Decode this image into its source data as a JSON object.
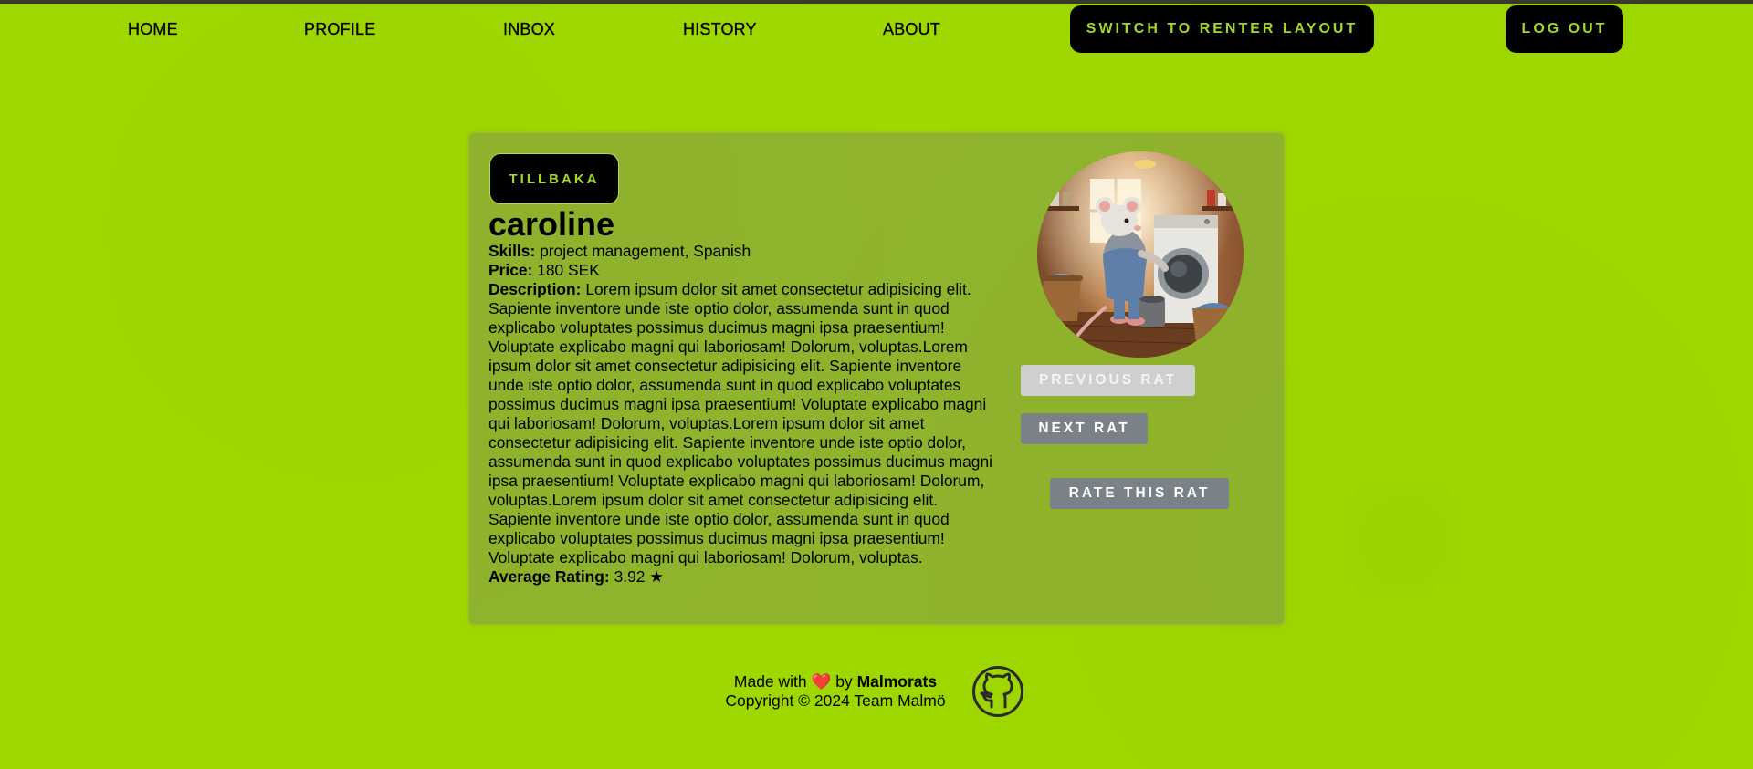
{
  "nav": {
    "home": "HOME",
    "profile": "PROFILE",
    "inbox": "INBOX",
    "history": "HISTORY",
    "about": "ABOUT",
    "switch_layout": "SWITCH TO RENTER LAYOUT",
    "logout": "LOG OUT"
  },
  "card": {
    "back_label": "TILLBAKA",
    "name": "caroline",
    "skills_label": "Skills:",
    "skills": "project management, Spanish",
    "price_label": "Price:",
    "price": "180 SEK",
    "description_label": "Description:",
    "description": "Lorem ipsum dolor sit amet consectetur adipisicing elit. Sapiente inventore unde iste optio dolor, assumenda sunt in quod explicabo voluptates possimus ducimus magni ipsa praesentium! Voluptate explicabo magni qui laboriosam! Dolorum, voluptas.Lorem ipsum dolor sit amet consectetur adipisicing elit. Sapiente inventore unde iste optio dolor, assumenda sunt in quod explicabo voluptates possimus ducimus magni ipsa praesentium! Voluptate explicabo magni qui laboriosam! Dolorum, voluptas.Lorem ipsum dolor sit amet consectetur adipisicing elit. Sapiente inventore unde iste optio dolor, assumenda sunt in quod explicabo voluptates possimus ducimus magni ipsa praesentium! Voluptate explicabo magni qui laboriosam! Dolorum, voluptas.Lorem ipsum dolor sit amet consectetur adipisicing elit. Sapiente inventore unde iste optio dolor, assumenda sunt in quod explicabo voluptates possimus ducimus magni ipsa praesentium! Voluptate explicabo magni qui laboriosam! Dolorum, voluptas.",
    "rating_label": "Average Rating:",
    "rating": "3.92 ★",
    "prev_label": "PREVIOUS RAT",
    "next_label": "NEXT RAT",
    "rate_label": "RATE THIS RAT",
    "photo_icon": "rat-laundry-photo"
  },
  "footer": {
    "made_with": "Made with",
    "heart": "❤️",
    "by": "by",
    "team": "Malmorats",
    "copyright": "Copyright © 2024 Team Malmö",
    "github_icon": "github-icon"
  },
  "colors": {
    "background": "#9fd800",
    "accent_text": "#a3d825",
    "button_dark": "#000000",
    "button_gray": "#7a8288",
    "button_disabled": "#cfcfcf"
  }
}
